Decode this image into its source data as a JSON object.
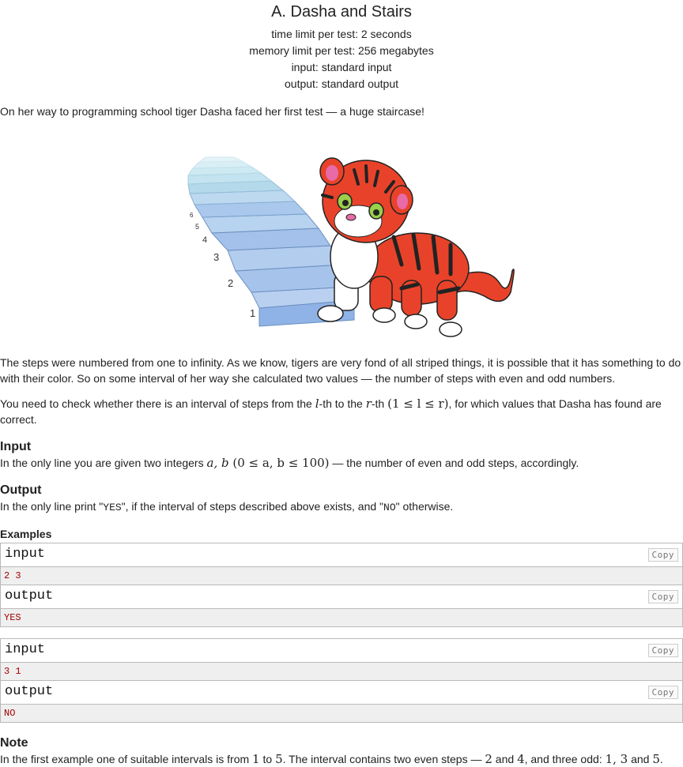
{
  "problem": {
    "title": "A. Dasha and Stairs",
    "time_limit": "time limit per test: 2 seconds",
    "memory_limit": "memory limit per test: 256 megabytes",
    "input": "input: standard input",
    "output": "output: standard output"
  },
  "statement": {
    "intro": "On her way to programming school tiger Dasha faced her first test — a huge staircase!",
    "para2": "The steps were numbered from one to infinity. As we know, tigers are very fond of all striped things, it is possible that it has something to do with their color. So on some interval of her way she calculated two values — the number of steps with even and odd numbers.",
    "para3_a": "You need to check whether there is an interval of steps from the ",
    "para3_l": "l",
    "para3_b": "-th to the ",
    "para3_r": "r",
    "para3_c": "-th ",
    "para3_cond": "(1 ≤ l ≤ r)",
    "para3_d": ", for which values that Dasha has found are correct."
  },
  "input_section": {
    "title": "Input",
    "text_a": "In the only line you are given two integers ",
    "vars": "a, b",
    "cond": " (0 ≤ a, b ≤ 100)",
    "text_b": " — the number of even and odd steps, accordingly."
  },
  "output_section": {
    "title": "Output",
    "text_a": "In the only line print \"",
    "yes": "YES",
    "text_b": "\", if the interval of steps described above exists, and \"",
    "no": "NO",
    "text_c": "\" otherwise."
  },
  "examples": {
    "title": "Examples",
    "copy_label": "Copy",
    "items": [
      {
        "input_label": "input",
        "input": "2 3",
        "output_label": "output",
        "output": "YES"
      },
      {
        "input_label": "input",
        "input": "3 1",
        "output_label": "output",
        "output": "NO"
      }
    ]
  },
  "note": {
    "title": "Note",
    "text_a": "In the first example one of suitable intervals is from ",
    "n1": "1",
    "text_b": " to ",
    "n5": "5",
    "text_c": ". The interval contains two even steps — ",
    "n2": "2",
    "text_d": " and ",
    "n4": "4",
    "text_e": ", and three odd: ",
    "odds": "1, 3",
    "text_f": " and ",
    "n5b": "5",
    "text_g": "."
  },
  "illustration": {
    "step_numbers": [
      "1",
      "2",
      "3",
      "4",
      "5",
      "6"
    ]
  }
}
